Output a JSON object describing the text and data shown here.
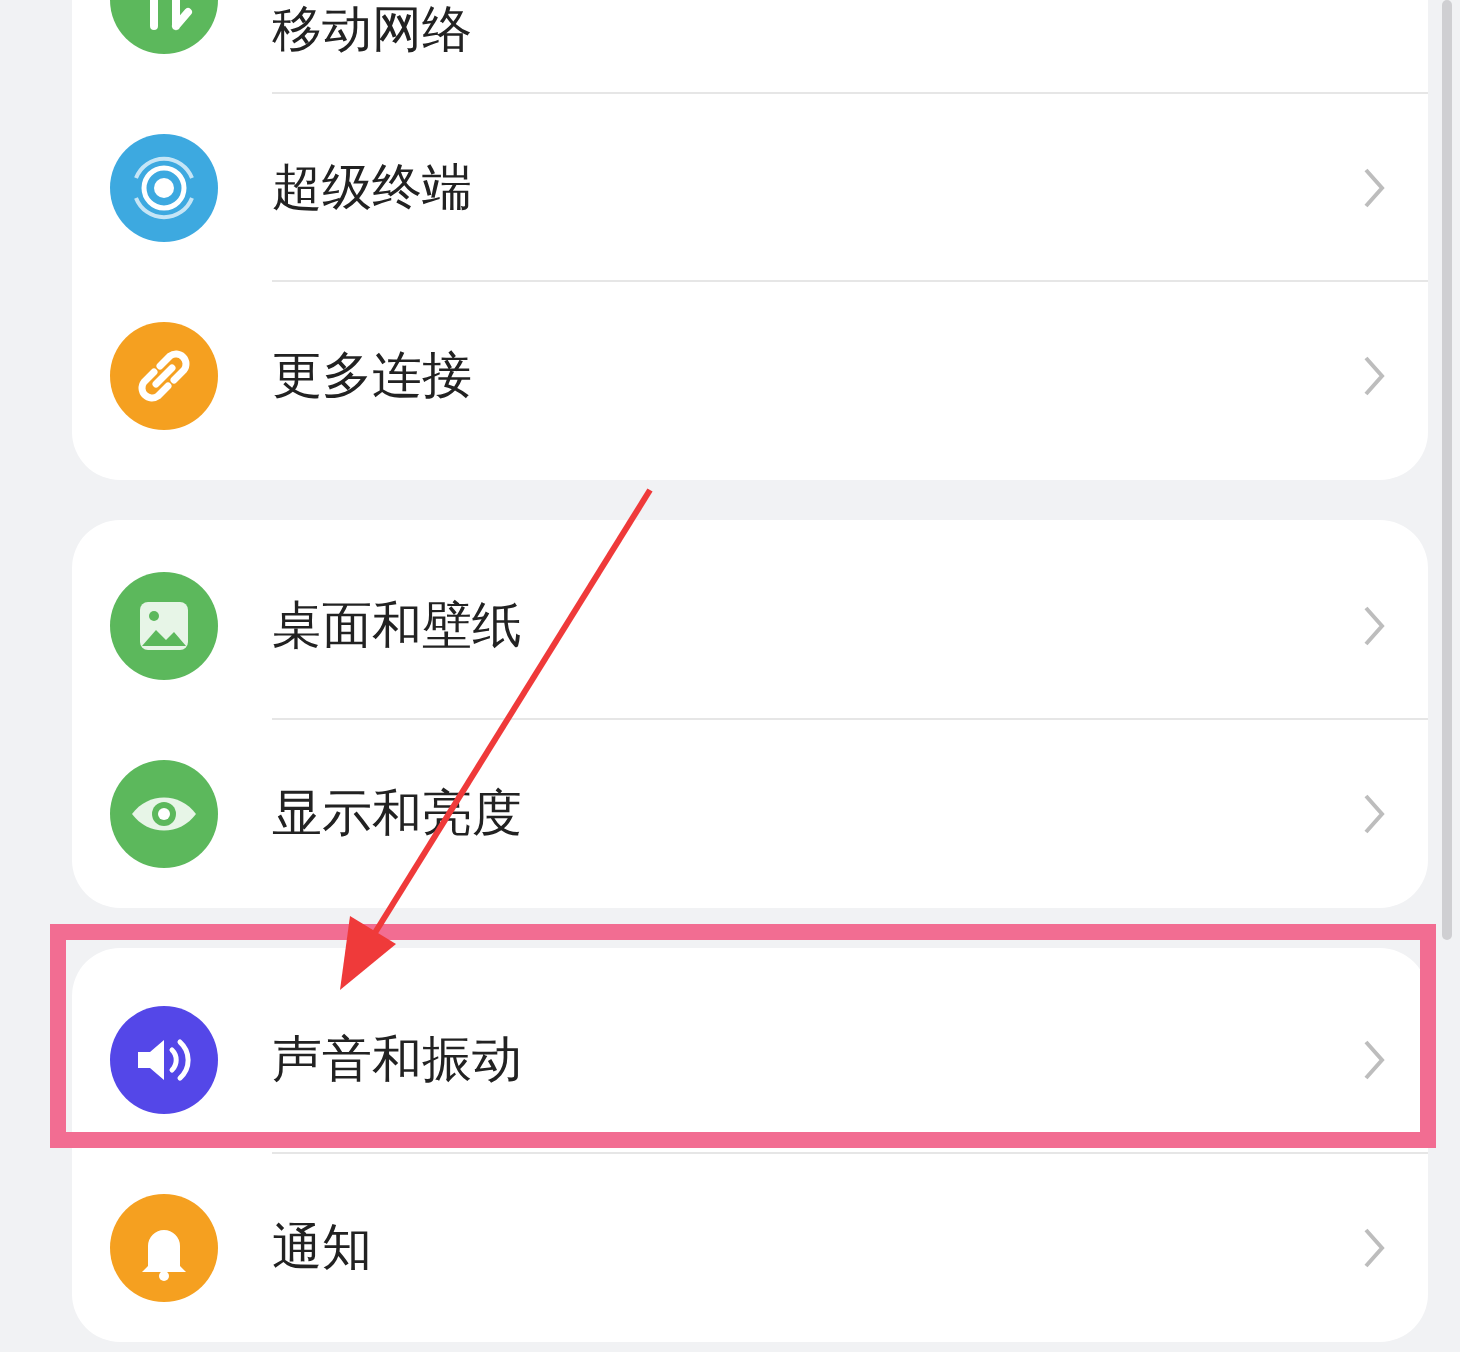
{
  "groups": [
    {
      "items": [
        {
          "label": "移动网络",
          "color": "#5cb85c",
          "highlighted": false
        },
        {
          "label": "超级终端",
          "color": "#3da9e0",
          "highlighted": false
        },
        {
          "label": "更多连接",
          "color": "#f5a020",
          "highlighted": false
        }
      ]
    },
    {
      "items": [
        {
          "label": "桌面和壁纸",
          "color": "#5cb85c",
          "highlighted": false
        },
        {
          "label": "显示和亮度",
          "color": "#5cb85c",
          "highlighted": false
        }
      ]
    },
    {
      "items": [
        {
          "label": "声音和振动",
          "color": "#5447e8",
          "highlighted": true
        },
        {
          "label": "通知",
          "color": "#f5a020",
          "highlighted": false
        }
      ]
    }
  ]
}
